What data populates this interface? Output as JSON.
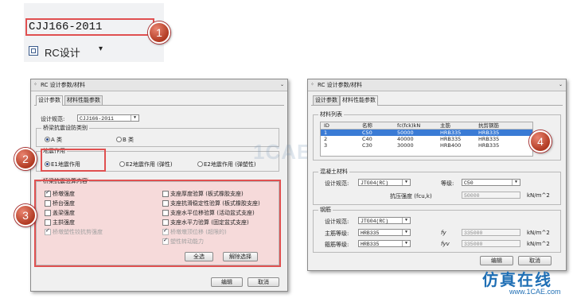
{
  "toolbar": {
    "code_text": "CJJ166-2011",
    "rc_label": "RC设计",
    "rc_arrow": "▾"
  },
  "badges": [
    "1",
    "2",
    "3",
    "4"
  ],
  "left_window": {
    "title": "RC 设计参数/材料",
    "tabs": [
      "设计参数",
      "材料性能参数"
    ],
    "design_code_label": "设计规范:",
    "design_code_value": "CJJ166-2011",
    "seismic_class": {
      "title": "桥梁抗震设防类别",
      "options": [
        "A 类",
        "B 类"
      ],
      "selected": 0
    },
    "seismic_action": {
      "title": "地震作用",
      "options": [
        "E1地震作用",
        "E2地震作用 (弹性)",
        "E2地震作用 (弹塑性)"
      ],
      "selected": 0
    },
    "check_content": {
      "title": "桥梁抗震验算内容",
      "left_items": [
        {
          "label": "桥墩强度",
          "checked": true,
          "disabled": false
        },
        {
          "label": "桥台强度",
          "checked": false,
          "disabled": false
        },
        {
          "label": "盖梁强度",
          "checked": false,
          "disabled": false
        },
        {
          "label": "主拱强度",
          "checked": false,
          "disabled": false
        },
        {
          "label": "桥墩塑性铰抗剪强度",
          "checked": true,
          "disabled": true
        }
      ],
      "right_items": [
        {
          "label": "支座厚度验算 (板式橡胶支座)",
          "checked": false,
          "disabled": false
        },
        {
          "label": "支座抗滑稳定性验算 (板式橡胶支座)",
          "checked": false,
          "disabled": false
        },
        {
          "label": "支座水平位移验算 (活动盆式支座)",
          "checked": false,
          "disabled": false
        },
        {
          "label": "支座水平力验算 (固定盆式支座)",
          "checked": false,
          "disabled": false
        },
        {
          "label": "桥墩墩顶位移 (超限的)",
          "checked": true,
          "disabled": true
        },
        {
          "label": "塑性转动能力",
          "checked": true,
          "disabled": true
        }
      ],
      "select_all": "全选",
      "deselect": "解除选择"
    },
    "edit_button": "编辑",
    "cancel_button": "取消"
  },
  "right_window": {
    "title": "RC 设计参数/材料",
    "tabs": [
      "设计参数",
      "材料性能参数"
    ],
    "material_list": {
      "title": "材料列表",
      "columns": [
        "ID",
        "名称",
        "fc(fck)kN",
        "主筋",
        "抗剪钢筋"
      ],
      "rows": [
        [
          "1",
          "C50",
          "50000",
          "HRB335",
          "HRB335"
        ],
        [
          "2",
          "C40",
          "40000",
          "HRB335",
          "HRB335"
        ],
        [
          "3",
          "C30",
          "30000",
          "HRB400",
          "HRB335"
        ]
      ],
      "selected_row": 0
    },
    "concrete": {
      "title": "混凝土材料",
      "code_label": "设计规范:",
      "code_value": "JTG04(RC)",
      "grade_label": "等级:",
      "grade_value": "C50",
      "strength_label": "抗压强度 (fcu,k)",
      "strength_value": "50000",
      "unit": "kN/m^2"
    },
    "rebar": {
      "title": "钢筋",
      "code_label": "设计规范:",
      "code_value": "JTG04(RC)",
      "main_label": "主筋等级:",
      "main_value": "HRB335",
      "main_sym": "fy",
      "main_strength": "335000",
      "stirrup_label": "箍筋等级:",
      "stirrup_value": "HRB335",
      "stirrup_sym": "fyv",
      "stirrup_strength": "335000",
      "unit": "kN/m^2"
    },
    "edit_button": "编辑",
    "cancel_button": "取消"
  },
  "watermark": {
    "center": "1CAE.COM",
    "brand": "仿真在线",
    "url": "www.1CAE.com"
  },
  "colors": {
    "highlight": "#e05050",
    "badge": "#c0442c",
    "selection": "#3a7bd5"
  }
}
